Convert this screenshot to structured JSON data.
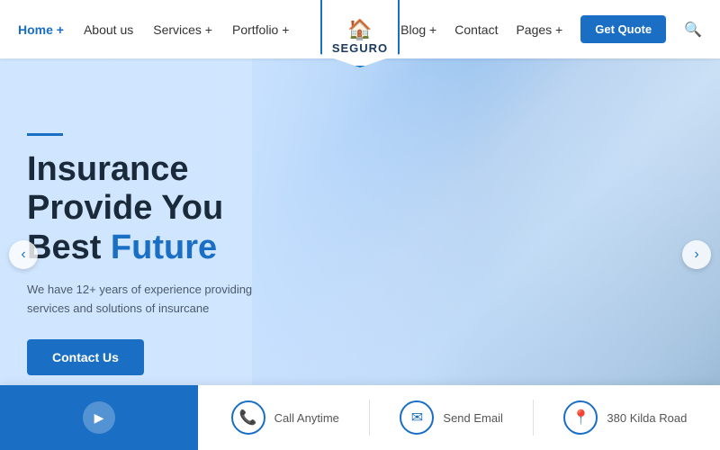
{
  "navbar": {
    "logo_text": "SEGURO",
    "nav_left": [
      {
        "label": "Home +",
        "active": true
      },
      {
        "label": "About us"
      },
      {
        "label": "Services +"
      },
      {
        "label": "Portfolio +"
      }
    ],
    "nav_right": [
      {
        "label": "Blog +"
      },
      {
        "label": "Contact"
      },
      {
        "label": "Pages +"
      }
    ],
    "quote_btn": "Get Quote"
  },
  "hero": {
    "accent": true,
    "title_line1": "Insurance",
    "title_line2": "Provide You",
    "title_line3_plain": "Best ",
    "title_line3_highlight": "Future",
    "subtitle": "We have 12+ years of experience providing services and solutions of insurcane",
    "cta_btn": "Contact Us"
  },
  "arrows": {
    "prev": "‹",
    "next": "›"
  },
  "bottom_bar": {
    "items": [
      {
        "icon": "📞",
        "label": "Call Anytime"
      },
      {
        "icon": "✉",
        "label": "Send Email"
      },
      {
        "icon": "📍",
        "label": "380 Kilda Road"
      }
    ]
  }
}
